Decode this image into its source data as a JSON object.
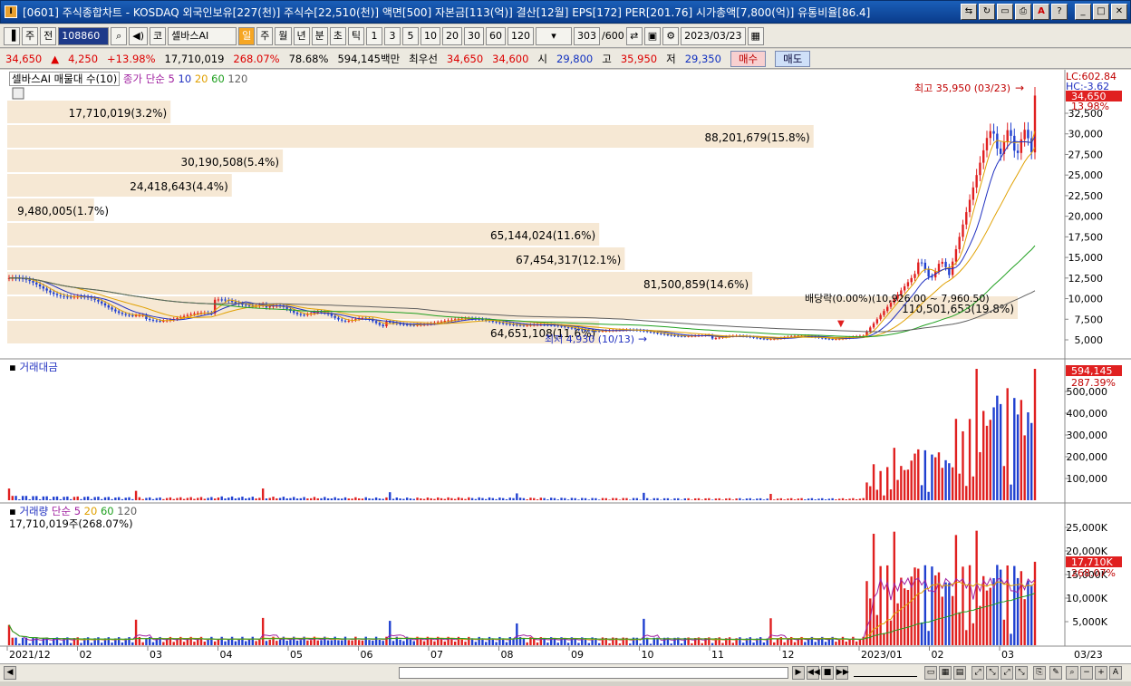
{
  "window": {
    "title": "[0601] 주식종합차트 - KOSDAQ 외국인보유[227(천)] 주식수[22,510(천)] 액면[500] 자본금[113(억)] 결산[12월] EPS[172] PER[201.76] 시가총액[7,800(억)] 유통비율[86.4]"
  },
  "toolbar": {
    "mode": "주",
    "prev": "전",
    "code": "108860",
    "market": "코",
    "name": "셀바스AI",
    "periods": [
      "일",
      "주",
      "월",
      "년",
      "분",
      "초",
      "틱"
    ],
    "nums": [
      "1",
      "3",
      "5",
      "10",
      "20",
      "30",
      "60",
      "120"
    ],
    "count": "303",
    "total": "/600",
    "date": "2023/03/23"
  },
  "quote": {
    "price": "34,650",
    "arrow": "▲",
    "change": "4,250",
    "rate": "+13.98%",
    "volume": "17,710,019",
    "vol_rate": "268.07%",
    "turnover": "78.68%",
    "amount": "594,145백만",
    "best": "최우선",
    "ask": "34,650",
    "bid": "34,600",
    "open_label": "시",
    "open": "29,800",
    "high_label": "고",
    "high": "35,950",
    "low_label": "저",
    "low": "29,350",
    "buy": "매수",
    "sell": "매도"
  },
  "price_panel": {
    "title": "셀바스AI 매물대 수(10)",
    "ma_label": "종가 단순",
    "ma_periods": [
      "5",
      "10",
      "20",
      "60",
      "120"
    ],
    "lc": "LC:602.84",
    "hc": "HC:-3.62",
    "cur": "34,650",
    "cur_rate": "13.98%",
    "high_note": "최고 35,950 (03/23)",
    "low_note": "최저 4,930 (10/13)",
    "dividend_note": "배당락(0.00%)(10,926.00 ~ 7,960.50)",
    "yticks": [
      "32,500",
      "30,000",
      "27,500",
      "25,000",
      "22,500",
      "20,000",
      "17,500",
      "15,000",
      "12,500",
      "10,000",
      "7,500",
      "5,000"
    ],
    "profile": [
      {
        "label": "17,710,019(3.2%)",
        "value": 3.2
      },
      {
        "label": "88,201,679(15.8%)",
        "value": 15.8
      },
      {
        "label": "30,190,508(5.4%)",
        "value": 5.4
      },
      {
        "label": "24,418,643(4.4%)",
        "value": 4.4
      },
      {
        "label": "9,480,005(1.7%)",
        "value": 1.7
      },
      {
        "label": "65,144,024(11.6%)",
        "value": 11.6
      },
      {
        "label": "67,454,317(12.1%)",
        "value": 12.1
      },
      {
        "label": "81,500,859(14.6%)",
        "value": 14.6
      },
      {
        "label": "110,501,653(19.8%)",
        "value": 19.8
      },
      {
        "label": "64,651,108(11.6%)",
        "value": 11.6
      }
    ]
  },
  "amount_panel": {
    "title": "거래대금",
    "cur": "594,145",
    "rate": "287.39%",
    "yticks": [
      "500,000",
      "400,000",
      "300,000",
      "200,000",
      "100,000"
    ]
  },
  "volume_panel": {
    "title": "거래량",
    "ma_label": "단순",
    "ma_periods": [
      "5",
      "20",
      "60",
      "120"
    ],
    "sub": "17,710,019주(268.07%)",
    "cur": "17,710K",
    "rate": "268.07%",
    "yticks": [
      "25,000K",
      "20,000K",
      "15,000K",
      "10,000K",
      "5,000K"
    ]
  },
  "xaxis": {
    "labels": [
      "2021/12",
      "02",
      "03",
      "04",
      "05",
      "06",
      "07",
      "08",
      "09",
      "10",
      "11",
      "12",
      "2023/01",
      "02",
      "03"
    ],
    "end": "03/23"
  },
  "colors": {
    "up": "#e02020",
    "down": "#2040d0",
    "ma5": "#e0a000",
    "ma10": "#2030c0",
    "ma20": "#e0a000",
    "ma60": "#20a020",
    "ma120": "#606060"
  }
}
